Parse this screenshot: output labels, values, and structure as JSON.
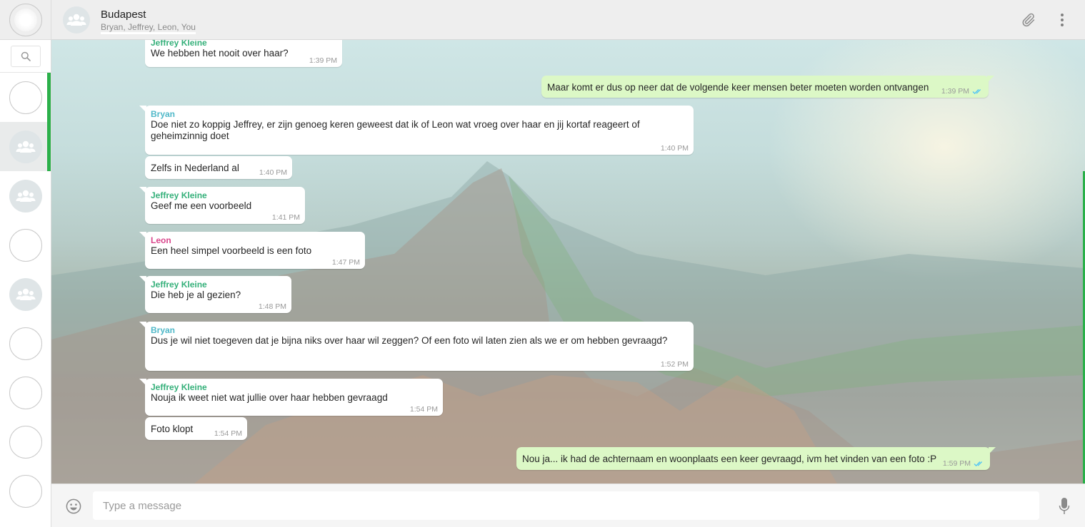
{
  "sidebar": {
    "search_icon": "search-icon",
    "chats": [
      {
        "type": "photo"
      },
      {
        "type": "group",
        "active": true
      },
      {
        "type": "group"
      },
      {
        "type": "photo"
      },
      {
        "type": "group"
      },
      {
        "type": "photo"
      },
      {
        "type": "photo"
      },
      {
        "type": "photo"
      },
      {
        "type": "photo"
      }
    ],
    "accent_color": "#2bb04a"
  },
  "header": {
    "title": "Budapest",
    "members": "Bryan, Jeffrey, Leon, You",
    "icons": [
      "paperclip-icon",
      "more-vertical-icon"
    ]
  },
  "messages": [
    {
      "direction": "in",
      "sender": "Jeffrey Kleine",
      "sender_color": "#35b07a",
      "text": "We hebben het nooit over haar?",
      "time": "1:39 PM"
    },
    {
      "direction": "out",
      "text": "Maar komt er dus op neer dat de volgende keer mensen beter moeten worden ontvangen",
      "time": "1:39 PM",
      "read": true
    },
    {
      "direction": "in",
      "sender": "Bryan",
      "sender_color": "#4fb8c8",
      "text": "Doe niet zo koppig Jeffrey, er zijn genoeg keren geweest dat ik of Leon wat vroeg over haar en jij kortaf reageert of geheimzinnig doet",
      "time": "1:40 PM"
    },
    {
      "direction": "in",
      "text": "Zelfs in Nederland al",
      "time": "1:40 PM"
    },
    {
      "direction": "in",
      "sender": "Jeffrey Kleine",
      "sender_color": "#35b07a",
      "text": "Geef me een voorbeeld",
      "time": "1:41 PM"
    },
    {
      "direction": "in",
      "sender": "Leon",
      "sender_color": "#d9468c",
      "text": "Een heel simpel voorbeeld is een foto",
      "time": "1:47 PM"
    },
    {
      "direction": "in",
      "sender": "Jeffrey Kleine",
      "sender_color": "#35b07a",
      "text": "Die heb je al gezien?",
      "time": "1:48 PM"
    },
    {
      "direction": "in",
      "sender": "Bryan",
      "sender_color": "#4fb8c8",
      "text": "Dus je wil niet toegeven dat je bijna niks over haar wil zeggen? Of een foto wil laten zien als we er om hebben gevraagd?",
      "time": "1:52 PM"
    },
    {
      "direction": "in",
      "sender": "Jeffrey Kleine",
      "sender_color": "#35b07a",
      "text": "Nouja ik weet niet wat jullie over haar hebben gevraagd",
      "time": "1:54 PM"
    },
    {
      "direction": "in",
      "text": "Foto klopt",
      "time": "1:54 PM"
    },
    {
      "direction": "out",
      "text": "Nou ja... ik had de achternaam en woonplaats een keer gevraagd, ivm het vinden van een foto :P",
      "time": "1:59 PM",
      "read": true
    }
  ],
  "composer": {
    "placeholder": "Type a message",
    "icons": [
      "emoji-icon",
      "microphone-icon"
    ]
  },
  "colors": {
    "header_bg": "#eeeeee",
    "outgoing_bubble": "#dcf8c6",
    "incoming_bubble": "#ffffff",
    "read_ticks": "#4fc3f7"
  }
}
